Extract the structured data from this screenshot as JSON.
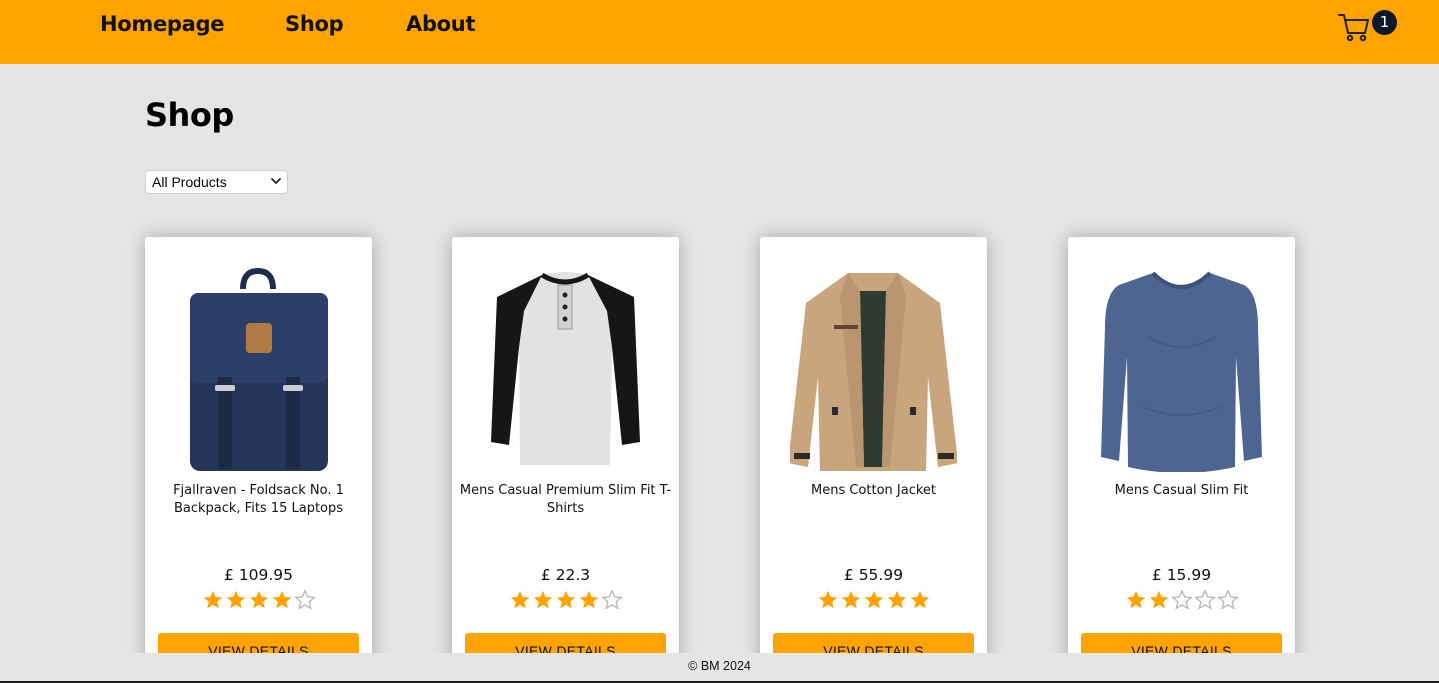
{
  "nav": {
    "links": [
      "Homepage",
      "Shop",
      "About"
    ],
    "cart_count": "1",
    "cart_icon": "shopping-cart-icon"
  },
  "page": {
    "title": "Shop",
    "filter_selected": "All Products"
  },
  "products": [
    {
      "name": "Fjallraven - Foldsack No. 1 Backpack, Fits 15 Laptops",
      "price": "£ 109.95",
      "rating": 4,
      "button": "VIEW DETAILS",
      "image": "navy-backpack"
    },
    {
      "name": "Mens Casual Premium Slim Fit T-Shirts",
      "price": "£ 22.3",
      "rating": 4,
      "button": "VIEW DETAILS",
      "image": "raglan-tshirt"
    },
    {
      "name": "Mens Cotton Jacket",
      "price": "£ 55.99",
      "rating": 5,
      "button": "VIEW DETAILS",
      "image": "beige-jacket"
    },
    {
      "name": "Mens Casual Slim Fit",
      "price": "£ 15.99",
      "rating": 2,
      "button": "VIEW DETAILS",
      "image": "blue-longsleeve"
    }
  ],
  "footer": {
    "text": "© BM 2024"
  },
  "colors": {
    "accent": "#ffa301",
    "badge": "#10182b",
    "star": "#ffa301",
    "star_empty": "#b5b5b5",
    "background": "#e5e5e5"
  }
}
